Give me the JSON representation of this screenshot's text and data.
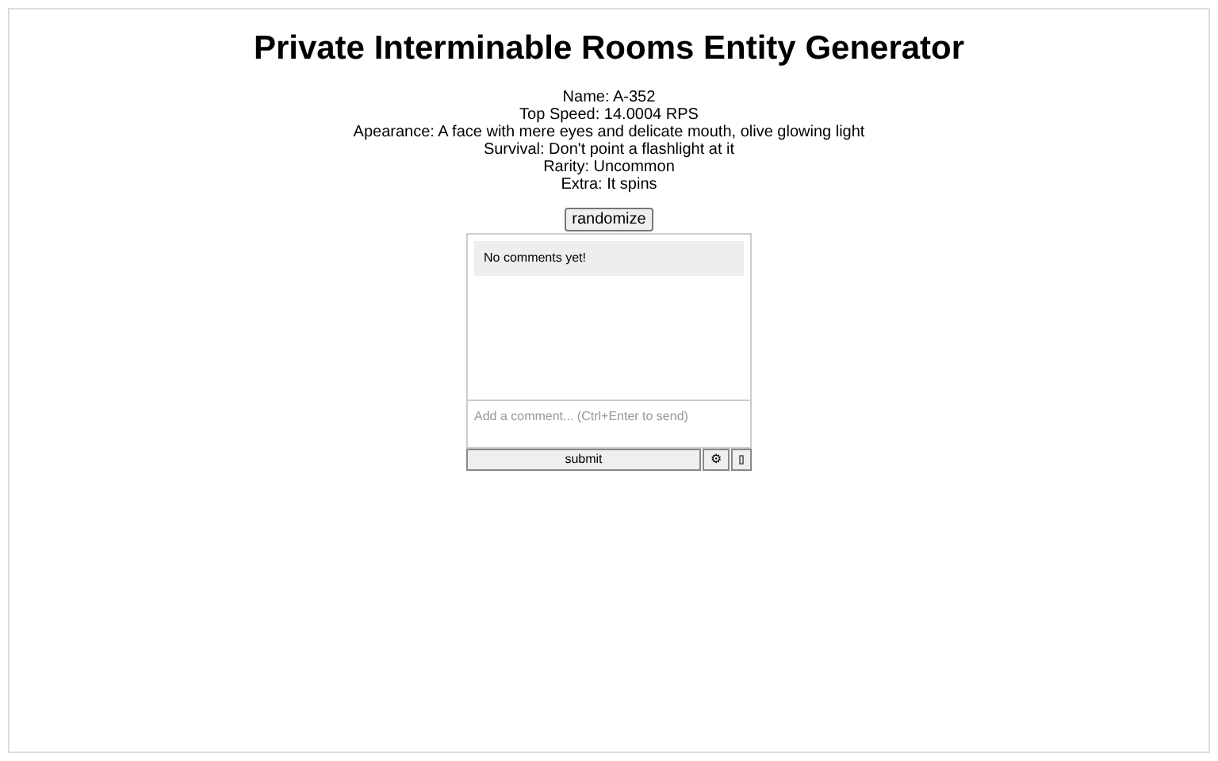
{
  "title": "Private Interminable Rooms Entity Generator",
  "details": [
    "Name: A-352",
    "Top Speed: 14.0004 RPS",
    "Apearance: A face with mere eyes and delicate mouth, olive glowing light",
    "Survival: Don't point a flashlight at it",
    "Rarity: Uncommon",
    "Extra: It spins"
  ],
  "randomize_button": "randomize",
  "comments": {
    "empty_message": "No comments yet!",
    "placeholder": "Add a comment... (Ctrl+Enter to send)",
    "submit_button": "submit",
    "settings_button": "⚙"
  }
}
